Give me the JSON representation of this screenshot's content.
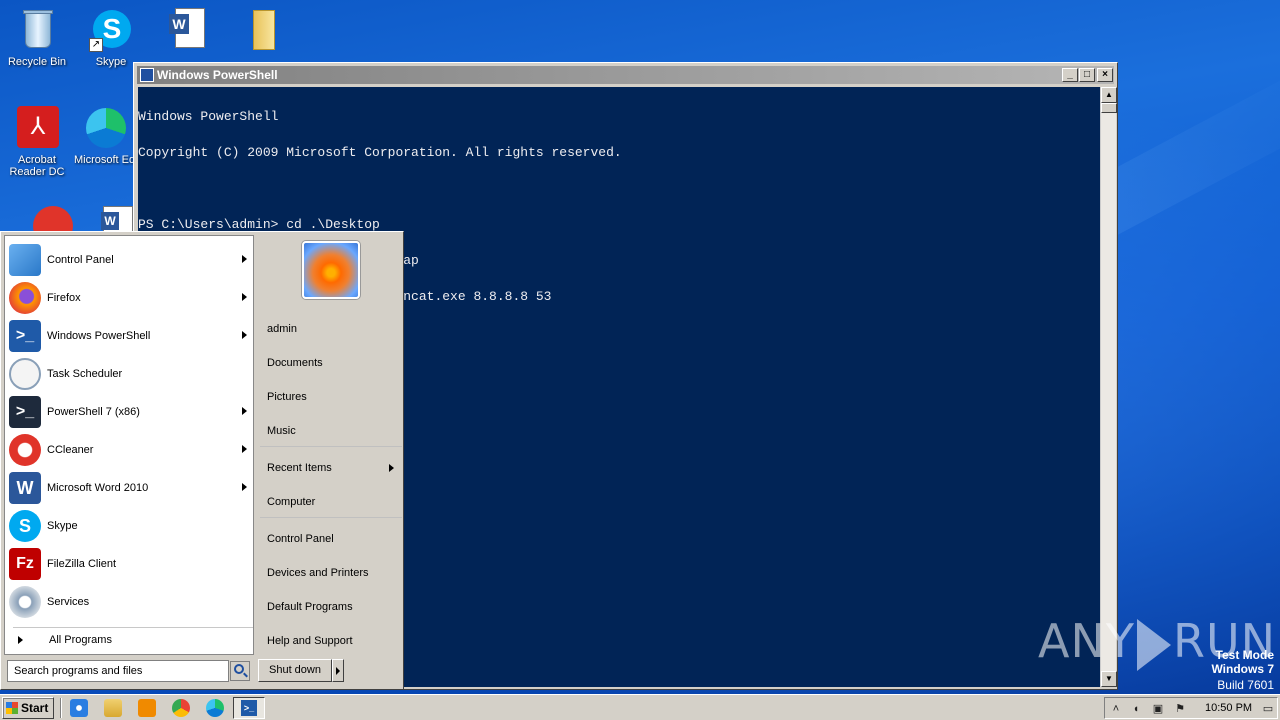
{
  "desktop": {
    "icons": [
      {
        "label": "Recycle Bin"
      },
      {
        "label": "Skype"
      },
      {
        "label": ""
      },
      {
        "label": ""
      },
      {
        "label": "Acrobat Reader DC"
      },
      {
        "label": "Microsoft Edge"
      }
    ]
  },
  "powershell": {
    "title": "Windows PowerShell",
    "lines": [
      "Windows PowerShell",
      "Copyright (C) 2009 Microsoft Corporation. All rights reserved.",
      "",
      "PS C:\\Users\\admin> cd .\\Desktop",
      "PS C:\\Users\\admin\\Desktop> cd .\\Nmap",
      "PS C:\\Users\\admin\\Desktop\\Nmap> .\\ncat.exe 8.8.8.8 53"
    ],
    "colors": {
      "background": "#012456",
      "text": "#eeedf0"
    }
  },
  "start_menu": {
    "programs": [
      {
        "label": "Control Panel",
        "icon": "control-panel-icon",
        "has_submenu": true
      },
      {
        "label": "Firefox",
        "icon": "firefox-icon",
        "has_submenu": true
      },
      {
        "label": "Windows PowerShell",
        "icon": "powershell-icon",
        "has_submenu": true
      },
      {
        "label": "Task Scheduler",
        "icon": "task-scheduler-icon",
        "has_submenu": false
      },
      {
        "label": "PowerShell 7 (x86)",
        "icon": "powershell7-icon",
        "has_submenu": true
      },
      {
        "label": "CCleaner",
        "icon": "ccleaner-icon",
        "has_submenu": true
      },
      {
        "label": "Microsoft Word 2010",
        "icon": "word-icon",
        "has_submenu": true
      },
      {
        "label": "Skype",
        "icon": "skype-icon",
        "has_submenu": false
      },
      {
        "label": "FileZilla Client",
        "icon": "filezilla-icon",
        "has_submenu": false
      },
      {
        "label": "Services",
        "icon": "services-icon",
        "has_submenu": false
      }
    ],
    "all_programs": "All Programs",
    "search_placeholder": "Search programs and files",
    "right_links": {
      "user": "admin",
      "documents": "Documents",
      "pictures": "Pictures",
      "music": "Music",
      "recent_items": "Recent Items",
      "computer": "Computer",
      "control_panel": "Control Panel",
      "devices_printers": "Devices and Printers",
      "default_programs": "Default Programs",
      "help_support": "Help and Support"
    },
    "shutdown_label": "Shut down"
  },
  "taskbar": {
    "start_label": "Start",
    "clock": "10:50 PM"
  },
  "watermark": {
    "brand_left": "ANY",
    "brand_right": "RUN",
    "line1": "Test Mode",
    "line2": "Windows 7",
    "line3": "Build 7601"
  }
}
